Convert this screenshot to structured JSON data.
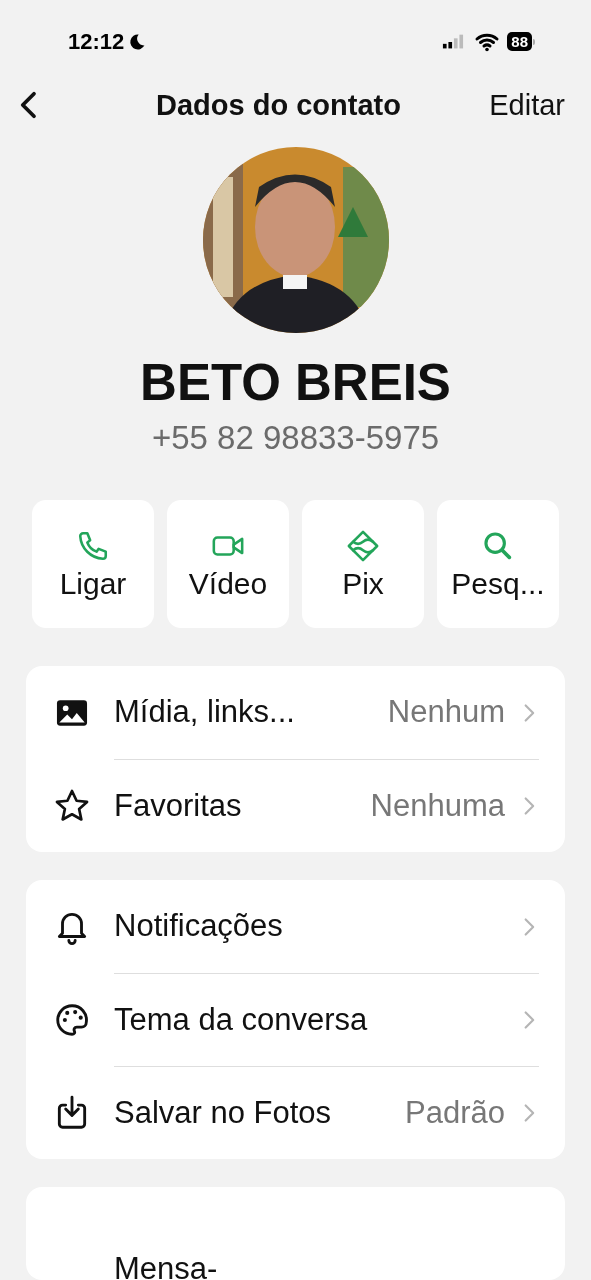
{
  "status_bar": {
    "time": "12:12",
    "battery": "88"
  },
  "nav": {
    "title": "Dados do contato",
    "action": "Editar"
  },
  "contact": {
    "name": "BETO BREIS",
    "phone": "+55 82 98833-5975"
  },
  "actions": [
    {
      "label": "Ligar"
    },
    {
      "label": "Vídeo"
    },
    {
      "label": "Pix"
    },
    {
      "label": "Pesq..."
    }
  ],
  "sections": [
    {
      "rows": [
        {
          "label": "Mídia, links...",
          "value": "Nenhum"
        },
        {
          "label": "Favoritas",
          "value": "Nenhuma"
        }
      ]
    },
    {
      "rows": [
        {
          "label": "Notificações"
        },
        {
          "label": "Tema da conversa"
        },
        {
          "label": "Salvar no Fotos",
          "value": "Padrão"
        }
      ]
    },
    {
      "rows": [
        {
          "label": "Mensa-"
        }
      ]
    }
  ]
}
